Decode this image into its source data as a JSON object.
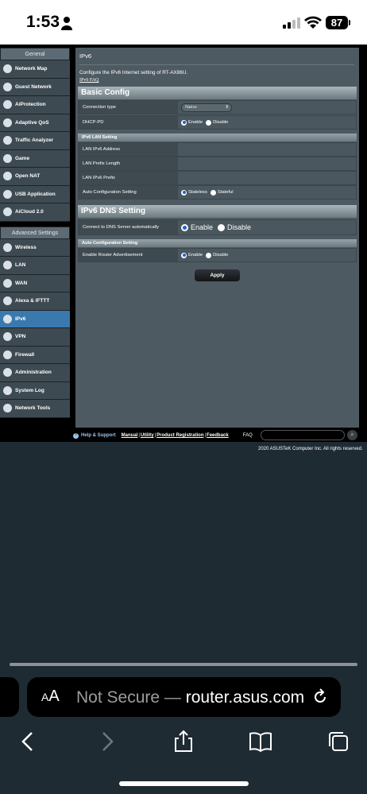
{
  "status_bar": {
    "time": "1:53",
    "battery": "87"
  },
  "sidebar": {
    "general_header": "General",
    "general_items": [
      {
        "label": "Network Map",
        "icon": "network-map-icon"
      },
      {
        "label": "Guest Network",
        "icon": "guest-network-icon"
      },
      {
        "label": "AiProtection",
        "icon": "aiprotection-icon"
      },
      {
        "label": "Adaptive QoS",
        "icon": "qos-icon"
      },
      {
        "label": "Traffic Analyzer",
        "icon": "traffic-analyzer-icon"
      },
      {
        "label": "Game",
        "icon": "game-icon"
      },
      {
        "label": "Open NAT",
        "icon": "open-nat-icon"
      },
      {
        "label": "USB Application",
        "icon": "usb-icon"
      },
      {
        "label": "AiCloud 2.0",
        "icon": "cloud-icon"
      }
    ],
    "advanced_header": "Advanced Settings",
    "advanced_items": [
      {
        "label": "Wireless",
        "icon": "wireless-icon"
      },
      {
        "label": "LAN",
        "icon": "lan-icon"
      },
      {
        "label": "WAN",
        "icon": "wan-icon"
      },
      {
        "label": "Alexa & IFTTT",
        "icon": "alexa-icon"
      },
      {
        "label": "IPv6",
        "icon": "ipv6-icon"
      },
      {
        "label": "VPN",
        "icon": "vpn-icon"
      },
      {
        "label": "Firewall",
        "icon": "firewall-icon"
      },
      {
        "label": "Administration",
        "icon": "administration-icon"
      },
      {
        "label": "System Log",
        "icon": "system-log-icon"
      },
      {
        "label": "Network Tools",
        "icon": "network-tools-icon"
      }
    ],
    "active": "IPv6"
  },
  "main": {
    "title": "IPv6",
    "description": "Configure the IPv6 Internet setting of RT-AX86U.",
    "faq_link": "IPv6 FAQ",
    "basic_config": {
      "header": "Basic Config",
      "connection_type_label": "Connection type",
      "connection_type_value": "Native",
      "dhcp_pd_label": "DHCP-PD",
      "enable": "Enable",
      "disable": "Disable"
    },
    "lan_setting": {
      "header": "IPv6 LAN Setting",
      "lan_address_label": "LAN IPv6 Address",
      "prefix_length_label": "LAN Prefix Length",
      "lan_prefix_label": "LAN IPv6 Prefix",
      "auto_config_label": "Auto Configuration Setting",
      "stateless": "Stateless",
      "stateful": "Stateful"
    },
    "dns_setting": {
      "header": "IPv6 DNS Setting",
      "connect_dns_label": "Connect to DNS Server automatically",
      "enable": "Enable",
      "disable": "Disable"
    },
    "auto_config": {
      "header": "Auto Configuration Setting",
      "router_adv_label": "Enable Router Advertisement",
      "enable": "Enable",
      "disable": "Disable"
    },
    "apply_label": "Apply"
  },
  "footer": {
    "help_support": "Help & Support",
    "manual": "Manual",
    "utility": "Utility",
    "product_registration": "Product Registration",
    "feedback": "Feedback",
    "faq": "FAQ",
    "copyright": "2020 ASUSTeK Computer Inc. All rights reserved."
  },
  "safari": {
    "aa_small": "A",
    "aa_big": "A",
    "not_secure": "Not Secure — ",
    "domain": "router.asus.com"
  }
}
